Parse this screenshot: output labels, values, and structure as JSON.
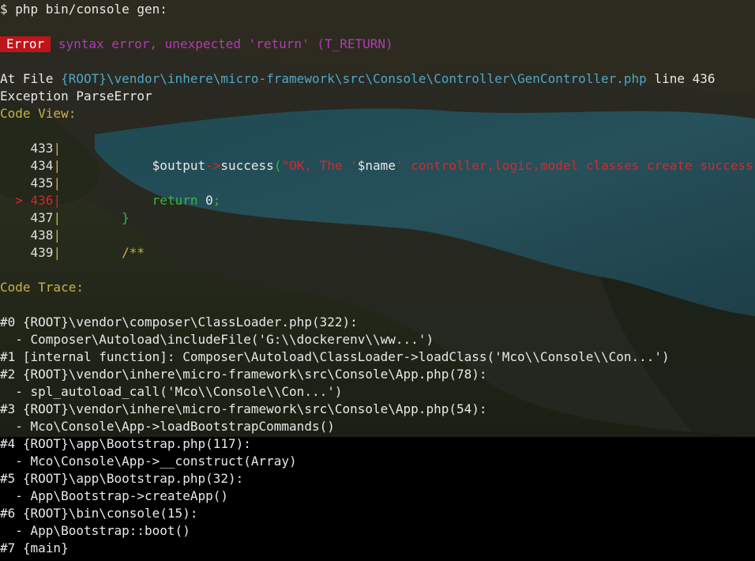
{
  "prompt": "$ php bin/console gen:",
  "error": {
    "badge": "Error",
    "message": "syntax error, unexpected 'return' (T_RETURN)"
  },
  "location": {
    "prefix": "At File ",
    "path": "{ROOT}\\vendor\\inhere\\micro-framework\\src\\Console\\Controller\\GenController.php",
    "line_label": " line 436"
  },
  "exception": "Exception ParseError",
  "code_view_label": "Code View:",
  "code_lines": [
    {
      "num": "433",
      "marker": "",
      "code_white": "",
      "code_parts": []
    },
    {
      "num": "434",
      "marker": "",
      "code_parts": [
        {
          "t": "        ",
          "c": "w"
        },
        {
          "t": "$output",
          "c": "w"
        },
        {
          "t": "->",
          "c": "red"
        },
        {
          "t": "success",
          "c": "w"
        },
        {
          "t": "(",
          "c": "green"
        },
        {
          "t": "\"OK, The '",
          "c": "red"
        },
        {
          "t": "$name",
          "c": "w"
        },
        {
          "t": "' controller,logic,model classes create success",
          "c": "red"
        }
      ]
    },
    {
      "num": "435",
      "marker": "",
      "code_parts": []
    },
    {
      "num": "436",
      "marker": "> ",
      "code_parts": [
        {
          "t": "        ",
          "c": "w"
        },
        {
          "t": "return ",
          "c": "green"
        },
        {
          "t": "0",
          "c": "w"
        },
        {
          "t": ";",
          "c": "green"
        }
      ]
    },
    {
      "num": "437",
      "marker": "",
      "code_parts": [
        {
          "t": "    ",
          "c": "w"
        },
        {
          "t": "}",
          "c": "green"
        }
      ]
    },
    {
      "num": "438",
      "marker": "",
      "code_parts": []
    },
    {
      "num": "439",
      "marker": "",
      "code_parts": [
        {
          "t": "    ",
          "c": "w"
        },
        {
          "t": "/**",
          "c": "yellow"
        }
      ]
    }
  ],
  "code_trace_label": "Code Trace:",
  "trace": [
    "#0 {ROOT}\\vendor\\composer\\ClassLoader.php(322):",
    "  - Composer\\Autoload\\includeFile('G:\\\\dockerenv\\\\ww...')",
    "#1 [internal function]: Composer\\Autoload\\ClassLoader->loadClass('Mco\\\\Console\\\\Con...')",
    "#2 {ROOT}\\vendor\\inhere\\micro-framework\\src\\Console\\App.php(78):",
    "  - spl_autoload_call('Mco\\\\Console\\\\Con...')",
    "#3 {ROOT}\\vendor\\inhere\\micro-framework\\src\\Console\\App.php(54):",
    "  - Mco\\Console\\App->loadBootstrapCommands()",
    "#4 {ROOT}\\app\\Bootstrap.php(117):",
    "  - Mco\\Console\\App->__construct(Array)",
    "#5 {ROOT}\\app\\Bootstrap.php(32):",
    "  - App\\Bootstrap->createApp()",
    "#6 {ROOT}\\bin\\console(15):",
    "  - App\\Bootstrap::boot()",
    "#7 {main}"
  ]
}
